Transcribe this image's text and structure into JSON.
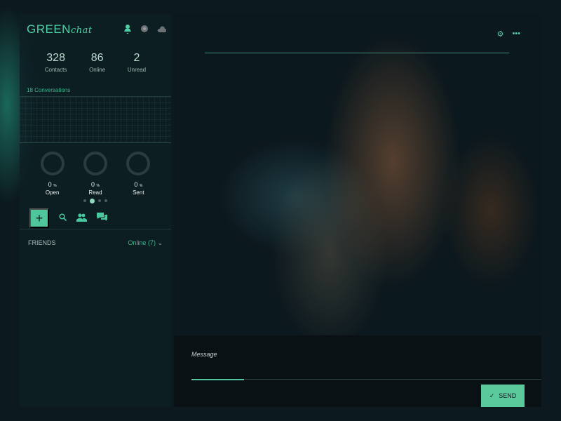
{
  "app": {
    "logo_main": "GREEN",
    "logo_sub": "chat"
  },
  "stats": [
    {
      "value": "328",
      "label": "Contacts"
    },
    {
      "value": "86",
      "label": "Online"
    },
    {
      "value": "2",
      "label": "Unread"
    }
  ],
  "conversations": "18 Conversations",
  "rings": [
    {
      "value": "0",
      "unit": "%",
      "label": "Open"
    },
    {
      "value": "0",
      "unit": "%",
      "label": "Read"
    },
    {
      "value": "0",
      "unit": "%",
      "label": "Sent"
    }
  ],
  "carousel": {
    "active_index": 1,
    "count": 4
  },
  "toolbar": {
    "add": "+"
  },
  "friends": {
    "title": "FRIENDS",
    "filter": "Online (7)"
  },
  "message": {
    "label": "Message",
    "send": "SEND",
    "input_progress": 0.15
  },
  "colors": {
    "accent": "#4fc69b"
  }
}
